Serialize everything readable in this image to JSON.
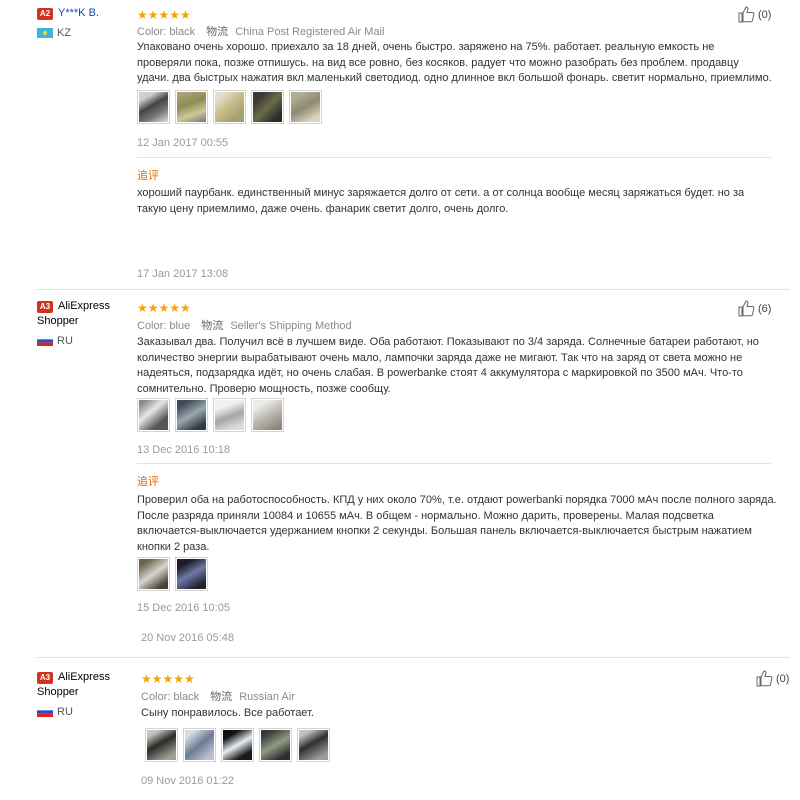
{
  "reviews": [
    {
      "level": "A2",
      "username": "Y***K B.",
      "country": "KZ",
      "stars": "★★★★★",
      "color_label": "Color:",
      "color_value": "black",
      "shipping_label": "物流",
      "shipping_value": "China Post Registered Air Mail",
      "like_count": "(0)",
      "text_lines": [
        "Упаковано очень хорошо. приехало за 18 дней, очень быстро. заряжено на 75%. работает. реальную емкость не",
        "проверяли пока, позже отпишусь. на вид все ровно, без косяков. радует что можно разобрать без проблем. продавцу",
        "удачи. два быстрых нажатия вкл маленький светодиод. одно длинное вкл большой фонарь. светит нормально, приемлимо."
      ],
      "photos": [
        "photo",
        "photo",
        "photo",
        "photo",
        "photo"
      ],
      "date": "12 Jan 2017 00:55",
      "followup_label": "追评",
      "followup_lines": [
        "хороший паурбанк. единственный минус заряжается долго от сети. а от солнца вообще месяц заряжаться будет. но за",
        "такую цену приемлимо, даже очень. фанарик светит долго, очень долго."
      ],
      "followup_date": "17 Jan 2017 13:08"
    },
    {
      "level": "A3",
      "username_line1": "AliExpress",
      "username_line2": "Shopper",
      "country": "RU",
      "stars": "★★★★★",
      "color_label": "Color:",
      "color_value": "blue",
      "shipping_label": "物流",
      "shipping_value": "Seller's Shipping Method",
      "like_count": "(6)",
      "text_lines": [
        "Заказывал два. Получил всё в лучшем виде. Оба работают. Показывают по 3/4 заряда. Солнечные батареи работают, но",
        "количество энергии вырабатывают очень мало, лампочки заряда даже не мигают. Так что на заряд от света можно не",
        "надеяться, подзарядка идёт, но очень слабая. В powerbanke стоят 4 аккумулятора с маркировкой по 3500 мАч. Что-то",
        "сомнительно. Проверю мощность, позже сообщу."
      ],
      "photos": [
        "photo",
        "photo",
        "photo",
        "photo"
      ],
      "date": "13 Dec 2016 10:18",
      "followup_label": "追评",
      "followup_lines": [
        "Проверил оба на работоспособность. КПД у них около 70%, т.е. отдают powerbanki порядка 7000 мАч после полного заряда.",
        "После разряда приняли 10084 и 10655 мАч. В общем - нормально. Можно дарить, проверены. Малая подсветка",
        "включается-выключается удержанием кнопки 2 секунды. Большая панель включается-выключается быстрым нажатием",
        "кнопки 2 раза."
      ],
      "followup_photos": [
        "photo",
        "photo"
      ],
      "followup_date": "15 Dec 2016 10:05",
      "extra_date": "20 Nov 2016 05:48"
    },
    {
      "level": "A3",
      "username_line1": "AliExpress",
      "username_line2": "Shopper",
      "country": "RU",
      "stars": "★★★★★",
      "color_label": "Color:",
      "color_value": "black",
      "shipping_label": "物流",
      "shipping_value": "Russian Air",
      "like_count": "(0)",
      "text_lines": [
        "Сыну понравилось. Все работает."
      ],
      "photos": [
        "photo",
        "photo",
        "photo",
        "photo",
        "photo"
      ],
      "date": "09 Nov 2016 01:22"
    }
  ],
  "colors": {
    "star": "#f5a300",
    "level_badge": "#d0321e",
    "followup": "#e26a00",
    "username_link": "#1a4aa8"
  },
  "icons": {
    "like": "thumbs-up-icon",
    "flag_kz": "kz-flag-icon",
    "flag_ru": "ru-flag-icon"
  }
}
